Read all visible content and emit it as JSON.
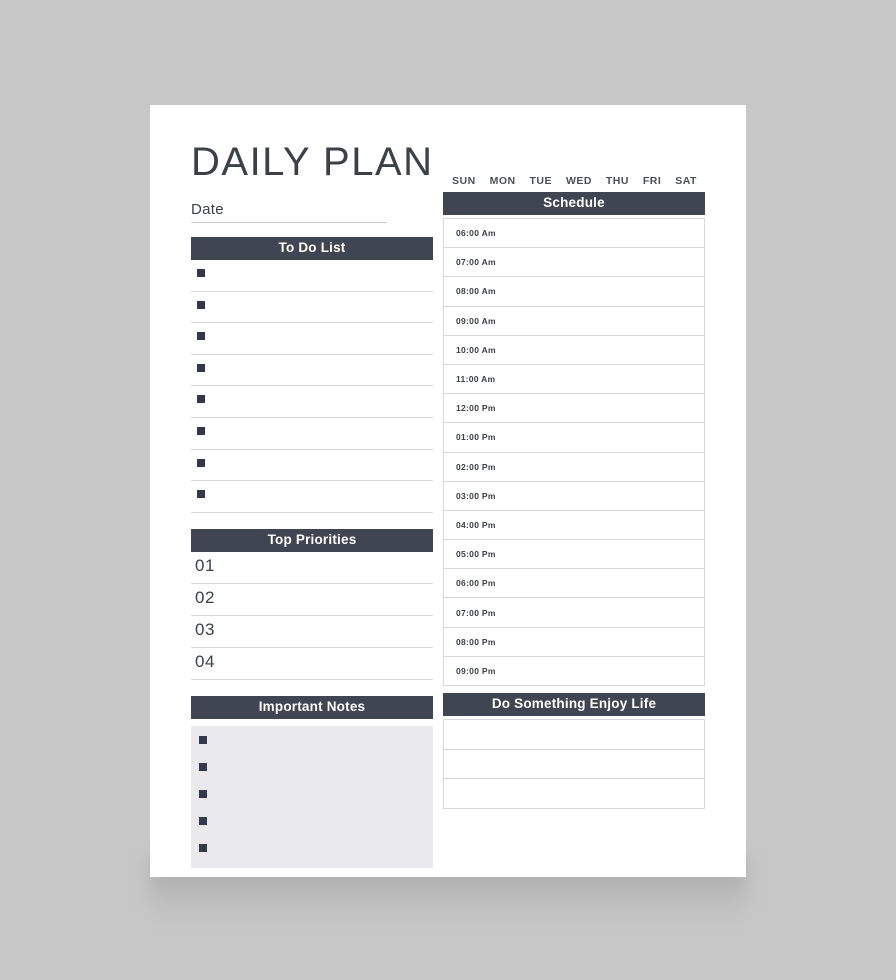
{
  "page": {
    "title": "DAILY PLAN",
    "background_color": "#c7c7c7",
    "sheet_color": "#ffffff",
    "accent_color": "#3f4551",
    "notes_box_color": "#eaeaec"
  },
  "date_field": {
    "label": "Date",
    "value": ""
  },
  "todo": {
    "heading": "To Do List",
    "items": [
      "",
      "",
      "",
      "",
      "",
      "",
      "",
      ""
    ]
  },
  "priorities": {
    "heading": "Top Priorities",
    "items": [
      {
        "number": "01",
        "value": ""
      },
      {
        "number": "02",
        "value": ""
      },
      {
        "number": "03",
        "value": ""
      },
      {
        "number": "04",
        "value": ""
      }
    ]
  },
  "notes": {
    "heading": "Important Notes",
    "items": [
      "",
      "",
      "",
      "",
      ""
    ]
  },
  "weekdays": [
    "SUN",
    "MON",
    "TUE",
    "WED",
    "THU",
    "FRI",
    "SAT"
  ],
  "schedule": {
    "heading": "Schedule",
    "rows": [
      {
        "time": "06:00 Am",
        "value": ""
      },
      {
        "time": "07:00 Am",
        "value": ""
      },
      {
        "time": "08:00 Am",
        "value": ""
      },
      {
        "time": "09:00 Am",
        "value": ""
      },
      {
        "time": "10:00 Am",
        "value": ""
      },
      {
        "time": "11:00 Am",
        "value": ""
      },
      {
        "time": "12:00 Pm",
        "value": ""
      },
      {
        "time": "01:00 Pm",
        "value": ""
      },
      {
        "time": "02:00 Pm",
        "value": ""
      },
      {
        "time": "03:00 Pm",
        "value": ""
      },
      {
        "time": "04:00 Pm",
        "value": ""
      },
      {
        "time": "05:00 Pm",
        "value": ""
      },
      {
        "time": "06:00 Pm",
        "value": ""
      },
      {
        "time": "07:00 Pm",
        "value": ""
      },
      {
        "time": "08:00 Pm",
        "value": ""
      },
      {
        "time": "09:00 Pm",
        "value": ""
      }
    ]
  },
  "enjoy": {
    "heading": "Do Something Enjoy Life",
    "rows": [
      "",
      "",
      ""
    ]
  }
}
